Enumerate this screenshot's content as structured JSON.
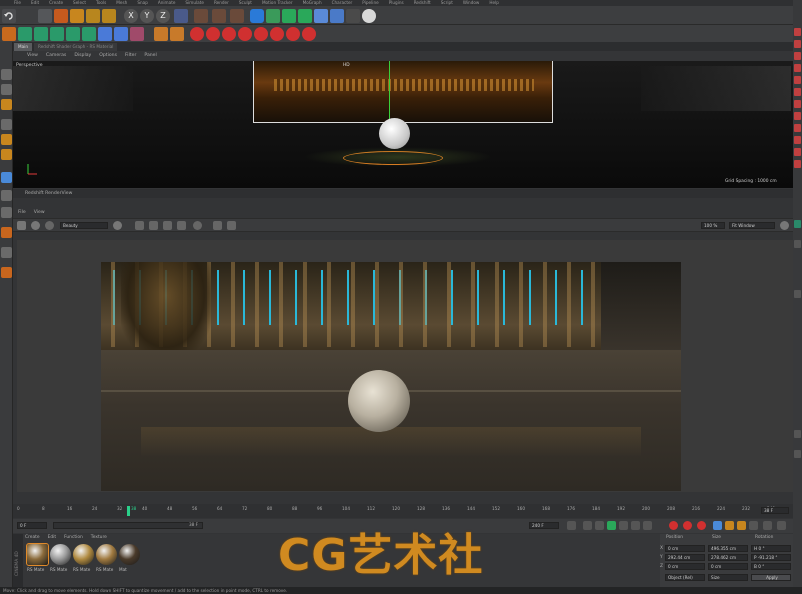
{
  "menubar": {
    "items": [
      "File",
      "Edit",
      "Create",
      "Select",
      "Tools",
      "Mesh",
      "Snap",
      "Animate",
      "Simulate",
      "Render",
      "Sculpt",
      "Motion Tracker",
      "MoGraph",
      "Character",
      "Pipeline",
      "Plugins",
      "Redshift",
      "Script",
      "Window",
      "Help"
    ]
  },
  "doc_tabs": [
    {
      "label": "Main",
      "active": true
    },
    {
      "label": "Redshift Shader Graph - RS Material",
      "active": false
    }
  ],
  "viewport": {
    "name": "Perspective",
    "menu": [
      "View",
      "Cameras",
      "Display",
      "Options",
      "Filter",
      "Panel"
    ],
    "grid_spacing": "Grid Spacing : 1000 cm",
    "axis_hint": "HD"
  },
  "renderview": {
    "title": "Redshift RenderView",
    "menu": [
      "File",
      "View"
    ],
    "aov": "Beauty",
    "zoom": "100 %",
    "fit_mode": "Fit Window"
  },
  "timeline": {
    "ticks": [
      "0",
      "8",
      "16",
      "24",
      "32",
      "40",
      "48",
      "56",
      "64",
      "72",
      "80",
      "88",
      "96",
      "104",
      "112",
      "120",
      "128",
      "136",
      "144",
      "152",
      "160",
      "168",
      "176",
      "184",
      "192",
      "200",
      "208",
      "216",
      "224",
      "232",
      "240"
    ],
    "current_frame": "38",
    "end_frame_box": "38 F",
    "start_field": "0 F",
    "start_field2": "0 F",
    "end_field": "240 F",
    "end_field2": "240 F",
    "frame_label": "38 F"
  },
  "materials": {
    "menu": [
      "Create",
      "Edit",
      "Function",
      "Texture"
    ],
    "items": [
      {
        "label": "RS Mate",
        "color": "#8a6a3a"
      },
      {
        "label": "RS Mate",
        "color": "#9a9a9a"
      },
      {
        "label": "RS Mate",
        "color": "#b08a40"
      },
      {
        "label": "RS Mate",
        "color": "#a07a40"
      },
      {
        "label": "Mat",
        "color": "#4a3a2a"
      }
    ],
    "cinema4d_brand": "CINEMA 4D"
  },
  "attributes": {
    "headers": [
      "Position",
      "Size",
      "Rotation"
    ],
    "rows": [
      {
        "axis": "X",
        "pos": "0 cm",
        "size": "496.355 cm",
        "rot": "H 0 °"
      },
      {
        "axis": "Y",
        "pos": "292.44 cm",
        "size": "278.462 cm",
        "rot": "P -91.218 °"
      },
      {
        "axis": "Z",
        "pos": "0 cm",
        "size": "0 cm",
        "rot": "B 0 °"
      }
    ],
    "coord_mode": "Object (Rel)",
    "size_mode": "Size",
    "apply": "Apply"
  },
  "watermark": "CG艺术社",
  "statusbar": "Move: Click and drag to move elements. Hold down SHIFT to quantize movement / add to the selection in point mode, CTRL to remove."
}
